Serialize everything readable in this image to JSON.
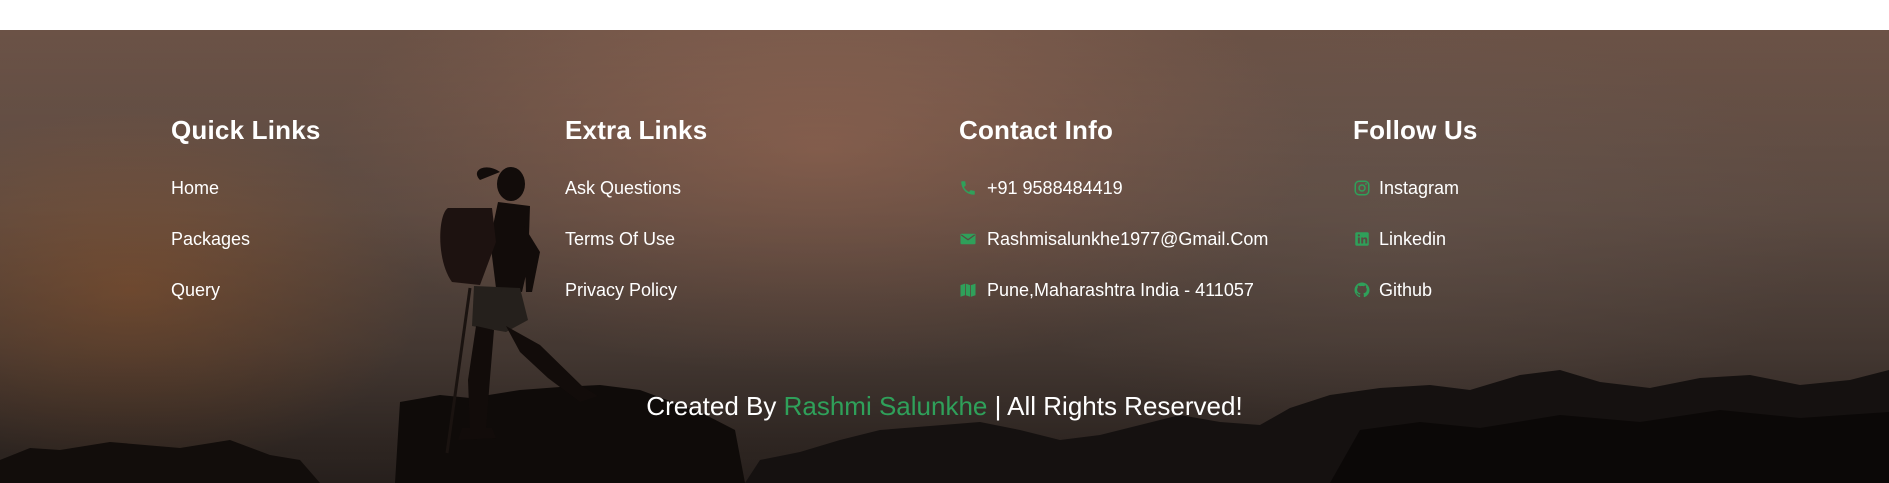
{
  "footer": {
    "columns": [
      {
        "title": "Quick Links",
        "links": [
          {
            "label": "Home"
          },
          {
            "label": "Packages"
          },
          {
            "label": "Query"
          }
        ]
      },
      {
        "title": "Extra Links",
        "links": [
          {
            "label": "Ask Questions"
          },
          {
            "label": "Terms Of Use"
          },
          {
            "label": "Privacy Policy"
          }
        ]
      },
      {
        "title": "Contact Info",
        "links": [
          {
            "label": "+91 9588484419",
            "icon": "phone-icon"
          },
          {
            "label": "Rashmisalunkhe1977@Gmail.Com",
            "icon": "envelope-icon"
          },
          {
            "label": "Pune,Maharashtra India - 411057",
            "icon": "map-icon"
          }
        ]
      },
      {
        "title": "Follow Us",
        "links": [
          {
            "label": "Instagram",
            "icon": "instagram-icon"
          },
          {
            "label": "Linkedin",
            "icon": "linkedin-icon"
          },
          {
            "label": "Github",
            "icon": "github-icon"
          }
        ]
      }
    ],
    "credit": {
      "prefix": "Created By ",
      "name": "Rashmi Salunkhe",
      "suffix": " | All Rights Reserved!"
    }
  },
  "colors": {
    "accent": "#2fa05a",
    "text": "#ffffff"
  }
}
